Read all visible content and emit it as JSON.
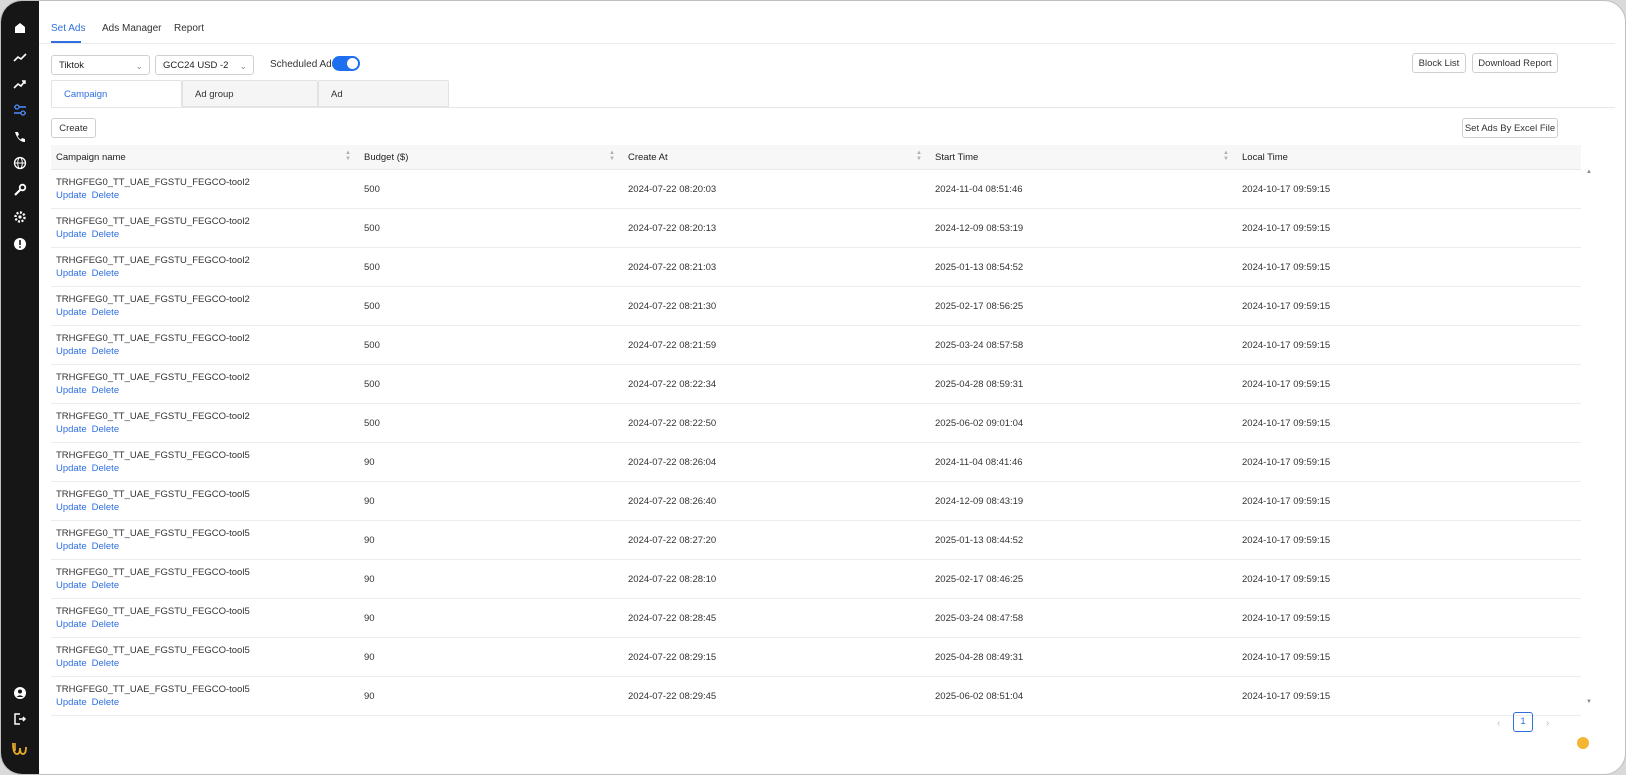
{
  "nav": {
    "tabs": [
      "Set Ads",
      "Ads Manager",
      "Report"
    ]
  },
  "filters": {
    "platform": "Tiktok",
    "account": "GCC24 USD -2",
    "scheduled_label": "Scheduled Ads"
  },
  "buttons": {
    "block_list": "Block List",
    "download_report": "Download Report",
    "create": "Create",
    "set_by_excel": "Set Ads By Excel File"
  },
  "subtabs": [
    "Campaign",
    "Ad group",
    "Ad"
  ],
  "table": {
    "columns": [
      "Campaign name",
      "Budget ($)",
      "Create At",
      "Start Time",
      "Local Time"
    ],
    "action_update": "Update",
    "action_delete": "Delete",
    "rows": [
      [
        "TRHGFEG0_TT_UAE_FGSTU_FEGCO-tool2",
        "500",
        "2024-07-22 08:20:03",
        "2024-11-04 08:51:46",
        "2024-10-17 09:59:15"
      ],
      [
        "TRHGFEG0_TT_UAE_FGSTU_FEGCO-tool2",
        "500",
        "2024-07-22 08:20:13",
        "2024-12-09 08:53:19",
        "2024-10-17 09:59:15"
      ],
      [
        "TRHGFEG0_TT_UAE_FGSTU_FEGCO-tool2",
        "500",
        "2024-07-22 08:21:03",
        "2025-01-13 08:54:52",
        "2024-10-17 09:59:15"
      ],
      [
        "TRHGFEG0_TT_UAE_FGSTU_FEGCO-tool2",
        "500",
        "2024-07-22 08:21:30",
        "2025-02-17 08:56:25",
        "2024-10-17 09:59:15"
      ],
      [
        "TRHGFEG0_TT_UAE_FGSTU_FEGCO-tool2",
        "500",
        "2024-07-22 08:21:59",
        "2025-03-24 08:57:58",
        "2024-10-17 09:59:15"
      ],
      [
        "TRHGFEG0_TT_UAE_FGSTU_FEGCO-tool2",
        "500",
        "2024-07-22 08:22:34",
        "2025-04-28 08:59:31",
        "2024-10-17 09:59:15"
      ],
      [
        "TRHGFEG0_TT_UAE_FGSTU_FEGCO-tool2",
        "500",
        "2024-07-22 08:22:50",
        "2025-06-02 09:01:04",
        "2024-10-17 09:59:15"
      ],
      [
        "TRHGFEG0_TT_UAE_FGSTU_FEGCO-tool5",
        "90",
        "2024-07-22 08:26:04",
        "2024-11-04 08:41:46",
        "2024-10-17 09:59:15"
      ],
      [
        "TRHGFEG0_TT_UAE_FGSTU_FEGCO-tool5",
        "90",
        "2024-07-22 08:26:40",
        "2024-12-09 08:43:19",
        "2024-10-17 09:59:15"
      ],
      [
        "TRHGFEG0_TT_UAE_FGSTU_FEGCO-tool5",
        "90",
        "2024-07-22 08:27:20",
        "2025-01-13 08:44:52",
        "2024-10-17 09:59:15"
      ],
      [
        "TRHGFEG0_TT_UAE_FGSTU_FEGCO-tool5",
        "90",
        "2024-07-22 08:28:10",
        "2025-02-17 08:46:25",
        "2024-10-17 09:59:15"
      ],
      [
        "TRHGFEG0_TT_UAE_FGSTU_FEGCO-tool5",
        "90",
        "2024-07-22 08:28:45",
        "2025-03-24 08:47:58",
        "2024-10-17 09:59:15"
      ],
      [
        "TRHGFEG0_TT_UAE_FGSTU_FEGCO-tool5",
        "90",
        "2024-07-22 08:29:15",
        "2025-04-28 08:49:31",
        "2024-10-17 09:59:15"
      ],
      [
        "TRHGFEG0_TT_UAE_FGSTU_FEGCO-tool5",
        "90",
        "2024-07-22 08:29:45",
        "2025-06-02 08:51:04",
        "2024-10-17 09:59:15"
      ]
    ]
  },
  "pagination": {
    "current": "1"
  },
  "colors": {
    "accent": "#2f6fe0",
    "sidebar": "#161616"
  }
}
